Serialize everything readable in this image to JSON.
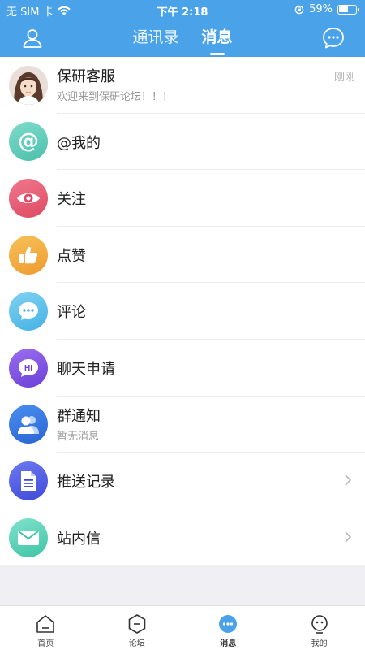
{
  "status_bar": {
    "carrier": "无 SIM 卡",
    "time": "下午 2:18",
    "battery": "59%",
    "battery_level": 0.59
  },
  "header": {
    "tabs": [
      {
        "label": "通讯录",
        "active": false
      },
      {
        "label": "消息",
        "active": true
      }
    ]
  },
  "messages": [
    {
      "title": "保研客服",
      "subtitle": "欢迎来到保研论坛！！！",
      "time": "刚刚",
      "icon": "avatar-photo"
    },
    {
      "title": "@我的",
      "icon": "at-icon",
      "color": "#5bc9b7"
    },
    {
      "title": "关注",
      "icon": "eye-icon",
      "color": "#e8566f"
    },
    {
      "title": "点赞",
      "icon": "thumbs-up-icon",
      "color": "#f0a93b"
    },
    {
      "title": "评论",
      "icon": "comment-icon",
      "color": "#4fb9e8"
    },
    {
      "title": "聊天申请",
      "icon": "hi-chat-icon",
      "color": "#7a4fe0"
    },
    {
      "title": "群通知",
      "subtitle": "暂无消息",
      "icon": "group-icon",
      "color": "#3273e0"
    },
    {
      "title": "推送记录",
      "icon": "document-icon",
      "color": "#4f5ce0",
      "chevron": true
    },
    {
      "title": "站内信",
      "icon": "envelope-icon",
      "color": "#4fd1b4",
      "chevron": true
    }
  ],
  "tabbar": {
    "items": [
      {
        "label": "首页",
        "icon": "home-icon"
      },
      {
        "label": "论坛",
        "icon": "forum-hexagon-icon"
      },
      {
        "label": "消息",
        "icon": "message-icon",
        "active": true
      },
      {
        "label": "我的",
        "icon": "profile-icon"
      }
    ]
  },
  "colors": {
    "primary": "#4aa3e8",
    "background": "#efeff4"
  }
}
